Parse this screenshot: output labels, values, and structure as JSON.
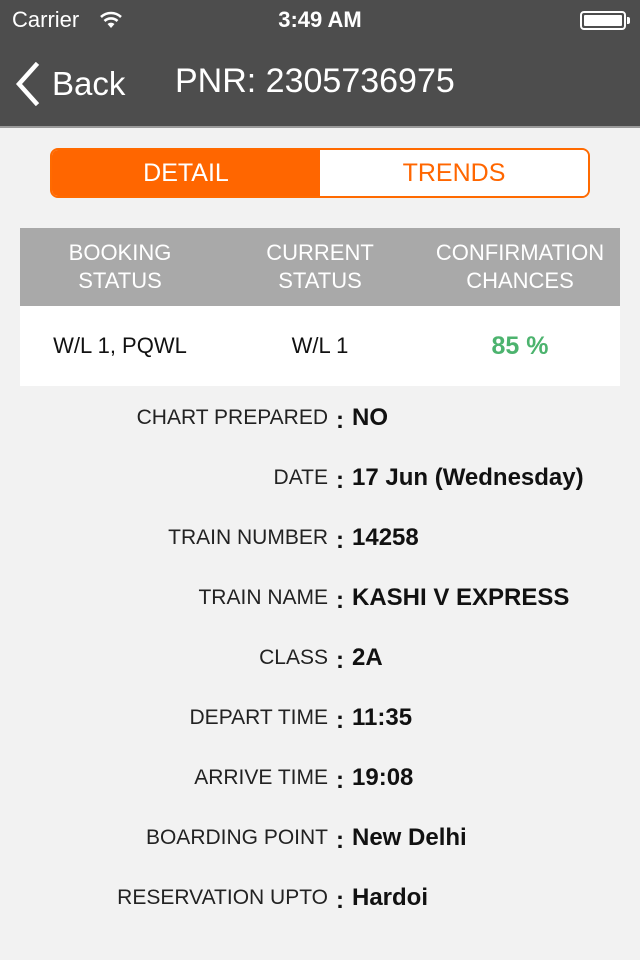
{
  "status_bar": {
    "carrier": "Carrier",
    "wifi_icon": "wifi-icon",
    "time": "3:49 AM",
    "battery_icon": "battery-full-icon",
    "battery_level": 1.0
  },
  "nav": {
    "back_label": "Back",
    "back_icon": "chevron-left-icon",
    "title": "PNR: 2305736975"
  },
  "tabs": [
    {
      "label": "DETAIL",
      "active": true
    },
    {
      "label": "TRENDS",
      "active": false
    }
  ],
  "status_table": {
    "headers": [
      {
        "line1": "BOOKING",
        "line2": "STATUS"
      },
      {
        "line1": "CURRENT",
        "line2": "STATUS"
      },
      {
        "line1": "CONFIRMATION",
        "line2": "CHANCES"
      }
    ],
    "row": {
      "booking_status": "W/L 1, PQWL",
      "current_status": "W/L 1",
      "confirmation_chances": "85 %"
    },
    "chance_color": "#4cb36e"
  },
  "details": [
    {
      "label": "CHART PREPARED",
      "value": "NO"
    },
    {
      "label": "DATE",
      "value": "17 Jun (Wednesday)"
    },
    {
      "label": "TRAIN NUMBER",
      "value": "14258"
    },
    {
      "label": "TRAIN NAME",
      "value": "KASHI V EXPRESS"
    },
    {
      "label": "CLASS",
      "value": "2A"
    },
    {
      "label": "DEPART TIME",
      "value": "11:35"
    },
    {
      "label": "ARRIVE TIME",
      "value": "19:08"
    },
    {
      "label": "BOARDING POINT",
      "value": "New Delhi"
    },
    {
      "label": "RESERVATION UPTO",
      "value": "Hardoi"
    }
  ],
  "separator": ":",
  "colors": {
    "accent": "#ff6600",
    "topbar": "#4d4d4d",
    "table_header": "#a9a9a9",
    "background": "#f2f2f2"
  }
}
